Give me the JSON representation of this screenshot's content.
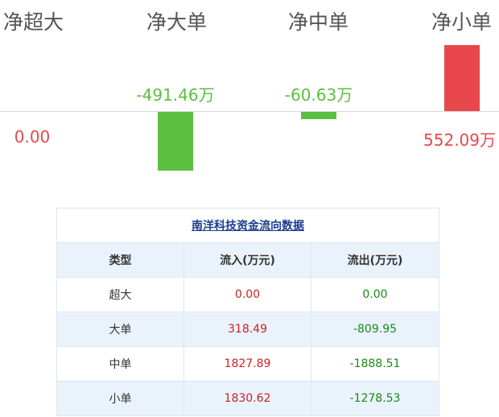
{
  "chart_data": {
    "type": "bar",
    "categories": [
      "净超大",
      "净大单",
      "净中单",
      "净小单"
    ],
    "values": [
      0.0,
      -491.46,
      -60.63,
      552.09
    ],
    "value_labels": [
      "0.00",
      "-491.46万",
      "-60.63万",
      "552.09万"
    ],
    "colors": {
      "positive": "#e8474b",
      "negative": "#5bbf40",
      "zero": "#e8474b"
    }
  },
  "table": {
    "caption": "南洋科技资金流向数据",
    "headers": [
      "类型",
      "流入(万元)",
      "流出(万元)"
    ],
    "rows": [
      {
        "type": "超大",
        "inflow": "0.00",
        "outflow": "0.00"
      },
      {
        "type": "大单",
        "inflow": "318.49",
        "outflow": "-809.95"
      },
      {
        "type": "中单",
        "inflow": "1827.89",
        "outflow": "-1888.51"
      },
      {
        "type": "小单",
        "inflow": "1830.62",
        "outflow": "-1278.53"
      }
    ]
  }
}
